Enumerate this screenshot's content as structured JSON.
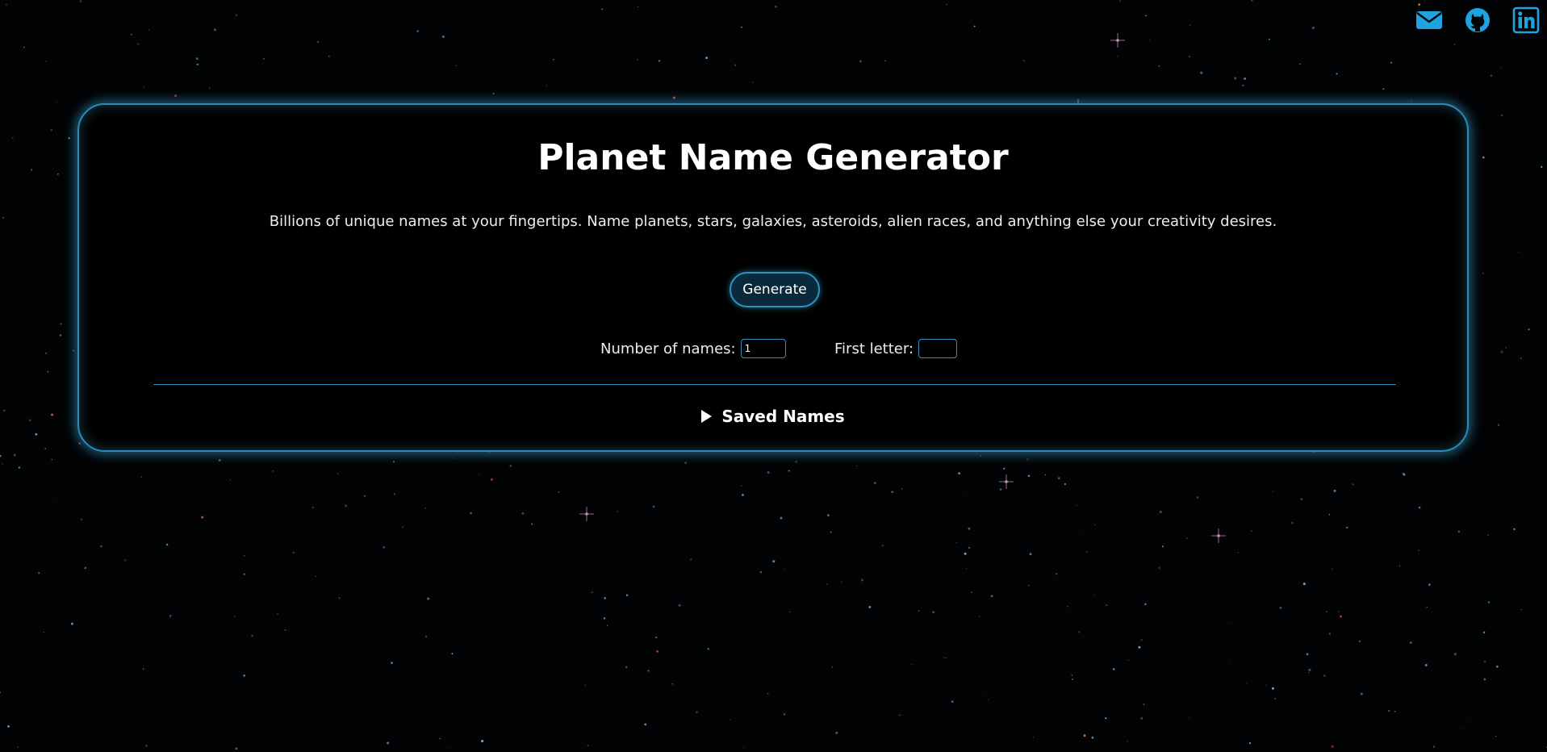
{
  "header": {
    "title": "Planet Name Generator",
    "subtitle": "Billions of unique names at your fingertips. Name planets, stars, galaxies, asteroids, alien races, and anything else your creativity desires."
  },
  "social": [
    {
      "icon": "envelope-icon",
      "label": "Email"
    },
    {
      "icon": "github-icon",
      "label": "GitHub"
    },
    {
      "icon": "linkedin-icon",
      "label": "LinkedIn"
    }
  ],
  "controls": {
    "generate_label": "Generate",
    "count_label": "Number of names:",
    "count_value": "1",
    "letter_label": "First letter:",
    "letter_value": ""
  },
  "saved": {
    "label": "Saved Names",
    "expanded": false
  },
  "colors": {
    "accent": "#2b93c2",
    "background": "#020305",
    "icon": "#1fa3e0",
    "text": "#ffffff"
  }
}
